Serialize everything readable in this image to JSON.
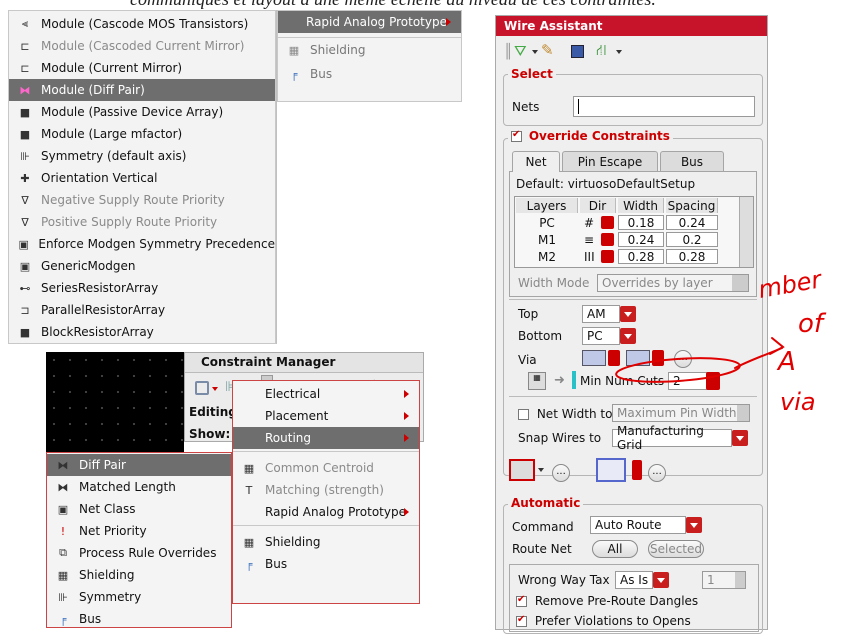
{
  "top_text": "communiqués et layout à une même échelle au niveau de ces contraintes.",
  "left_menu": {
    "items": [
      {
        "label": "Module (Cascode MOS Transistors)",
        "icon": "cascode-mos-icon",
        "state": "normal"
      },
      {
        "label": "Module (Cascoded Current Mirror)",
        "icon": "cascoded-mirror-icon",
        "state": "disabled"
      },
      {
        "label": "Module (Current Mirror)",
        "icon": "current-mirror-icon",
        "state": "normal"
      },
      {
        "label": "Module (Diff Pair)",
        "icon": "diff-pair-icon",
        "state": "selected"
      },
      {
        "label": "Module (Passive Device Array)",
        "icon": "passive-array-icon",
        "state": "normal"
      },
      {
        "label": "Module (Large mfactor)",
        "icon": "large-mfactor-icon",
        "state": "normal"
      },
      {
        "label": "Symmetry (default axis)",
        "icon": "symmetry-axis-icon",
        "state": "normal"
      },
      {
        "label": "Orientation Vertical",
        "icon": "orientation-icon",
        "state": "normal"
      },
      {
        "label": "Negative Supply Route Priority",
        "icon": "negative-supply-icon",
        "state": "disabled"
      },
      {
        "label": "Positive Supply Route Priority",
        "icon": "positive-supply-icon",
        "state": "disabled"
      },
      {
        "label": "Enforce Modgen Symmetry Precedence",
        "icon": "modgen-symmetry-icon",
        "state": "normal"
      },
      {
        "label": "GenericModgen",
        "icon": "generic-modgen-icon",
        "state": "normal"
      },
      {
        "label": "SeriesResistorArray",
        "icon": "series-resistor-icon",
        "state": "normal"
      },
      {
        "label": "ParallelResistorArray",
        "icon": "parallel-resistor-icon",
        "state": "normal"
      },
      {
        "label": "BlockResistorArray",
        "icon": "block-resistor-icon",
        "state": "normal"
      }
    ]
  },
  "right_menu_top": {
    "header": "Rapid Analog Prototype",
    "items": [
      {
        "label": "Shielding",
        "icon": "shielding-icon"
      },
      {
        "label": "Bus",
        "icon": "bus-icon"
      }
    ]
  },
  "constraint_manager": {
    "title": "Constraint Manager",
    "editing_label": "Editing",
    "show_label": "Show:",
    "menu": {
      "items": [
        {
          "label": "Electrical",
          "arrow": true,
          "state": "normal"
        },
        {
          "label": "Placement",
          "arrow": true,
          "state": "normal"
        },
        {
          "label": "Routing",
          "arrow": true,
          "state": "selected"
        },
        {
          "label": "Common Centroid",
          "arrow": false,
          "state": "disabled"
        },
        {
          "label": "Matching (strength)",
          "arrow": false,
          "state": "disabled"
        },
        {
          "label": "Rapid Analog Prototype",
          "arrow": true,
          "state": "normal"
        },
        {
          "label": "Shielding",
          "arrow": false,
          "state": "normal"
        },
        {
          "label": "Bus",
          "arrow": false,
          "state": "normal"
        }
      ]
    },
    "routing_submenu": {
      "items": [
        {
          "label": "Diff Pair",
          "icon": "diff-pair-icon",
          "state": "selected"
        },
        {
          "label": "Matched Length",
          "icon": "matched-length-icon",
          "state": "normal"
        },
        {
          "label": "Net Class",
          "icon": "net-class-icon",
          "state": "normal"
        },
        {
          "label": "Net Priority",
          "icon": "net-priority-icon",
          "state": "normal"
        },
        {
          "label": "Process Rule Overrides",
          "icon": "process-rule-icon",
          "state": "normal"
        },
        {
          "label": "Shielding",
          "icon": "shielding-icon",
          "state": "normal"
        },
        {
          "label": "Symmetry",
          "icon": "symmetry-icon",
          "state": "normal"
        },
        {
          "label": "Bus",
          "icon": "bus-icon",
          "state": "normal"
        }
      ]
    }
  },
  "wire_assistant": {
    "title": "Wire Assistant",
    "select_group": "Select",
    "nets_label": "Nets",
    "nets_value": "",
    "override_label": "Override Constraints",
    "tabs": [
      "Net",
      "Pin Escape",
      "Bus"
    ],
    "active_tab": "Net",
    "default_text": "Default: virtuosoDefaultSetup",
    "table": {
      "headers": [
        "Layers",
        "Dir",
        "Width",
        "Spacing"
      ],
      "rows": [
        {
          "layer": "PC",
          "dir": "#",
          "width": "0.18",
          "spacing": "0.24"
        },
        {
          "layer": "M1",
          "dir": "≡",
          "width": "0.24",
          "spacing": "0.2"
        },
        {
          "layer": "M2",
          "dir": "III",
          "width": "0.28",
          "spacing": "0.28"
        }
      ]
    },
    "width_mode_label": "Width Mode",
    "width_mode_value": "Overrides by layer",
    "top_label": "Top",
    "top_value": "AM",
    "bottom_label": "Bottom",
    "bottom_value": "PC",
    "via_label": "Via",
    "min_num_cuts_label": "Min Num Cuts",
    "min_num_cuts_value": "2",
    "net_width_label": "Net Width to",
    "net_width_value": "Maximum Pin Width",
    "snap_label": "Snap Wires to",
    "snap_value": "Manufacturing Grid",
    "more_label": "...",
    "automatic_group": "Automatic",
    "command_label": "Command",
    "command_value": "Auto Route",
    "route_net_label": "Route Net",
    "all_label": "All",
    "selected_label": "Selected",
    "wrong_way_label": "Wrong Way Tax",
    "wrong_way_value": "As Is",
    "wrong_way_num": "1",
    "remove_dangles_label": "Remove Pre-Route Dangles",
    "prefer_violations_label": "Prefer Violations to Opens"
  },
  "colors": {
    "accent": "#c00000",
    "selected": "#6e6e6e",
    "annotation": "#e00000"
  }
}
